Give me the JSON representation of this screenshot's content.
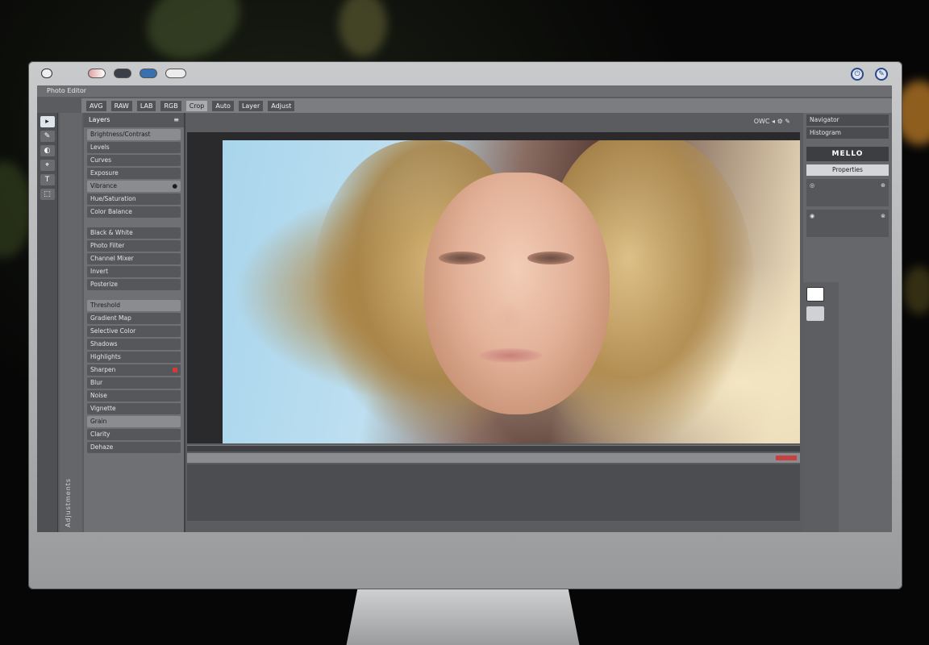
{
  "window": {
    "title_buttons": [
      "close",
      "minimize",
      "zoom",
      "fullscreen",
      "new-tab"
    ],
    "right_icons": [
      "power-icon",
      "edit-icon"
    ]
  },
  "menubar": {
    "label": "Photo Editor"
  },
  "options_bar": {
    "items": [
      "AVG",
      "RAW",
      "LAB",
      "RGB",
      "Crop",
      "Auto",
      "Layer",
      "Adjust"
    ],
    "selected_index": 4
  },
  "tools": [
    "▸",
    "✎",
    "◐",
    "⌖",
    "T",
    "⬚"
  ],
  "vertical_label": "Adjustments",
  "left_panel": {
    "header": "Layers",
    "rows": [
      {
        "label": "Brightness/Contrast",
        "value": ""
      },
      {
        "label": "Levels",
        "value": ""
      },
      {
        "label": "Curves",
        "value": ""
      },
      {
        "label": "Exposure",
        "value": ""
      },
      {
        "label": "Vibrance",
        "value": "●"
      },
      {
        "label": "Hue/Saturation",
        "value": ""
      },
      {
        "label": "Color Balance",
        "value": ""
      },
      {
        "label": "Black & White",
        "value": ""
      },
      {
        "label": "Photo Filter",
        "value": ""
      },
      {
        "label": "Channel Mixer",
        "value": ""
      },
      {
        "label": "Invert",
        "value": ""
      },
      {
        "label": "Posterize",
        "value": ""
      },
      {
        "label": "Threshold",
        "value": ""
      },
      {
        "label": "Gradient Map",
        "value": ""
      },
      {
        "label": "Selective Color",
        "value": ""
      },
      {
        "label": "Shadows",
        "value": ""
      },
      {
        "label": "Highlights",
        "value": ""
      },
      {
        "label": "Sharpen",
        "value": "●"
      },
      {
        "label": "Blur",
        "value": ""
      },
      {
        "label": "Noise",
        "value": ""
      },
      {
        "label": "Vignette",
        "value": ""
      },
      {
        "label": "Grain",
        "value": ""
      },
      {
        "label": "Clarity",
        "value": ""
      },
      {
        "label": "Dehaze",
        "value": ""
      }
    ]
  },
  "document": {
    "header_text": "OWC ◂ ⚙ ✎"
  },
  "right_panel": {
    "top_rows": [
      "Navigator",
      "Histogram"
    ],
    "title": "MELLO",
    "light_row": "Properties",
    "blocks": [
      {
        "left": "◎",
        "right": "⊕"
      },
      {
        "left": "◉",
        "right": "⊗"
      }
    ]
  },
  "colors": {
    "accent": "#3a6fb0",
    "warning": "#c84040"
  }
}
